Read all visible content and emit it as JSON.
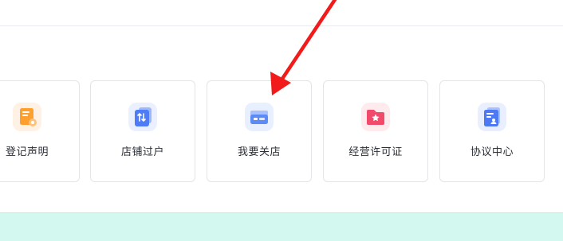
{
  "services": [
    {
      "label": "登记声明",
      "icon": "orange-document-icon",
      "color": "#ff9f2e"
    },
    {
      "label": "店铺过户",
      "icon": "blue-transfer-icon",
      "color": "#4d7cf6"
    },
    {
      "label": "我要关店",
      "icon": "blue-store-box-icon",
      "color": "#5d8bf6"
    },
    {
      "label": "经营许可证",
      "icon": "red-license-folder-icon",
      "color": "#f24a6a"
    },
    {
      "label": "协议中心",
      "icon": "blue-agreement-icon",
      "color": "#4e79f4"
    }
  ],
  "annotation": {
    "icon": "red-arrow-icon",
    "color": "#f21b1b"
  },
  "colors": {
    "bottom_band": "#d3f8ef",
    "card_border": "#e3e5e9"
  }
}
